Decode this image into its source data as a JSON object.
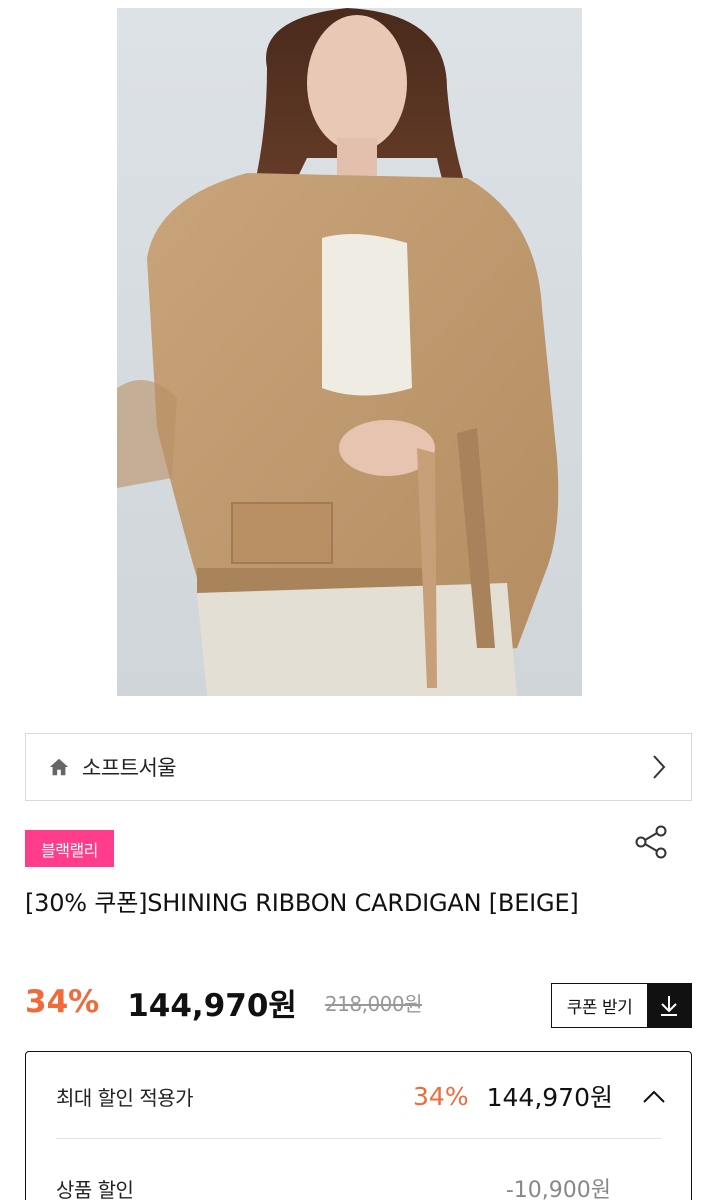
{
  "product": {
    "image_alt": "model wearing beige knit cardigan",
    "brand": {
      "name": "소프트서울"
    },
    "badge": "블랙랠리",
    "title": "[30% 쿠폰]SHINING RIBBON CARDIGAN [BEIGE]",
    "price": {
      "discount_rate": "34%",
      "sale_price": "144,970원",
      "original_price": "218,000원"
    },
    "coupon_button": "쿠폰 받기"
  },
  "discount_panel": {
    "max_label": "최대 할인 적용가",
    "max_rate": "34%",
    "max_price": "144,970원",
    "product_discount_label": "상품 할인",
    "product_discount_value": "-10,900원"
  },
  "icons": {
    "home": "home-icon",
    "chevron": "chevron-right-icon",
    "share": "share-icon",
    "download": "download-icon",
    "collapse": "chevron-up-icon"
  },
  "colors": {
    "accent_discount": "#f06a3a",
    "badge_bg": "#ff3d8b",
    "text": "#111111",
    "strike": "#999999"
  }
}
